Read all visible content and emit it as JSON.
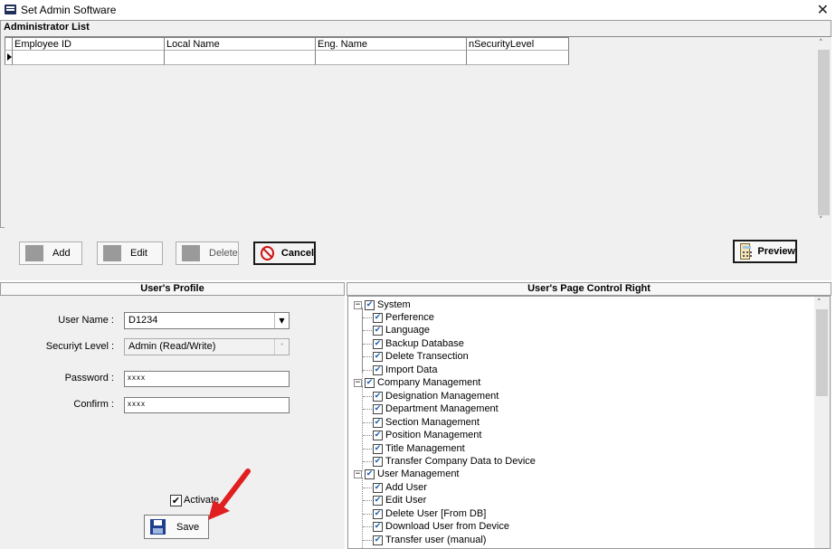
{
  "window": {
    "title": "Set Admin Software",
    "icon": "app-icon",
    "close": "✕"
  },
  "admin_list": {
    "title": "Administrator List",
    "columns": [
      "Employee ID",
      "Local Name",
      "Eng. Name",
      "nSecurityLevel"
    ],
    "rows": [
      [
        "",
        "",
        "",
        ""
      ]
    ]
  },
  "toolbar": {
    "add": "Add",
    "edit": "Edit",
    "delete": "Delete",
    "cancel": "Cancel",
    "preview": "Preview"
  },
  "profile": {
    "header": "User's Profile",
    "user_name_label": "User Name :",
    "user_name_value": "D1234",
    "security_level_label": "Securiyt Level :",
    "security_level_value": "Admin (Read/Write)",
    "password_label": "Password :",
    "password_value": "xxxx",
    "confirm_label": "Confirm :",
    "confirm_value": "xxxx",
    "activate_label": "Activate",
    "activate_checked": true,
    "save_label": "Save"
  },
  "rights": {
    "header": "User's Page Control Right",
    "groups": [
      {
        "label": "System",
        "checked": true,
        "expanded": true,
        "children": [
          "Perference",
          "Language",
          "Backup Database",
          "Delete Transection",
          "Import Data"
        ]
      },
      {
        "label": "Company Management",
        "checked": true,
        "expanded": true,
        "children": [
          "Designation Management",
          "Department Management",
          "Section Management",
          "Position Management",
          "Title Management",
          "Transfer Company Data to Device"
        ]
      },
      {
        "label": "User Management",
        "checked": true,
        "expanded": true,
        "children": [
          "Add User",
          "Edit User",
          "Delete User [From DB]",
          "Download User from Device",
          "Transfer user (manual)"
        ]
      }
    ]
  },
  "colors": {
    "annotation_arrow": "#e02020",
    "checkmark": "#1a5fb4",
    "cancel_icon": "#d01010"
  }
}
